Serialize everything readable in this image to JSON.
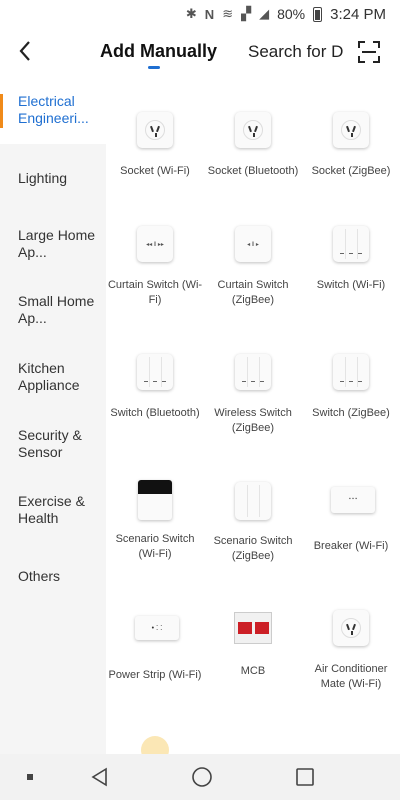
{
  "status_bar": {
    "icons": [
      "bluetooth-icon",
      "nfc-icon",
      "wifi-icon",
      "mute-icon",
      "signal-icon",
      "battery-icon"
    ],
    "battery": "80%",
    "time": "3:24 PM"
  },
  "header": {
    "title": "Add Manually",
    "search_tab": "Search for D",
    "accent": "#1f6fd1"
  },
  "sidebar": {
    "items": [
      {
        "label": "Electrical Engineeri..."
      },
      {
        "label": "Lighting"
      },
      {
        "label": "Large Home Ap..."
      },
      {
        "label": "Small Home Ap..."
      },
      {
        "label": "Kitchen Appliance"
      },
      {
        "label": "Security & Sensor"
      },
      {
        "label": "Exercise & Health"
      },
      {
        "label": "Others"
      }
    ],
    "active_index": 0,
    "active_indicator_color": "#f08a19"
  },
  "devices": [
    {
      "label": "Socket (Wi-Fi)",
      "icon": "socket-icon"
    },
    {
      "label": "Socket (Bluetooth)",
      "icon": "socket-icon"
    },
    {
      "label": "Socket (ZigBee)",
      "icon": "socket-icon"
    },
    {
      "label": "Curtain Switch (Wi-Fi)",
      "icon": "curtain-switch-icon"
    },
    {
      "label": "Curtain Switch (ZigBee)",
      "icon": "curtain-switch-icon"
    },
    {
      "label": "Switch (Wi-Fi)",
      "icon": "switch-icon"
    },
    {
      "label": "Switch (Bluetooth)",
      "icon": "switch-icon"
    },
    {
      "label": "Wireless Switch (ZigBee)",
      "icon": "switch-icon"
    },
    {
      "label": "Switch (ZigBee)",
      "icon": "switch-icon"
    },
    {
      "label": "Scenario Switch (Wi-Fi)",
      "icon": "scenario-switch-icon"
    },
    {
      "label": "Scenario Switch (ZigBee)",
      "icon": "switch-icon"
    },
    {
      "label": "Breaker (Wi-Fi)",
      "icon": "breaker-icon"
    },
    {
      "label": "Power Strip (Wi-Fi)",
      "icon": "power-strip-icon"
    },
    {
      "label": "MCB",
      "icon": "mcb-icon"
    },
    {
      "label": "Air Conditioner Mate (Wi-Fi)",
      "icon": "socket-icon"
    },
    {
      "label": "",
      "icon": "bulb-icon"
    }
  ],
  "navbar": {
    "buttons": [
      "recents-dot-icon",
      "back-triangle-icon",
      "home-circle-icon",
      "overview-square-icon"
    ]
  }
}
